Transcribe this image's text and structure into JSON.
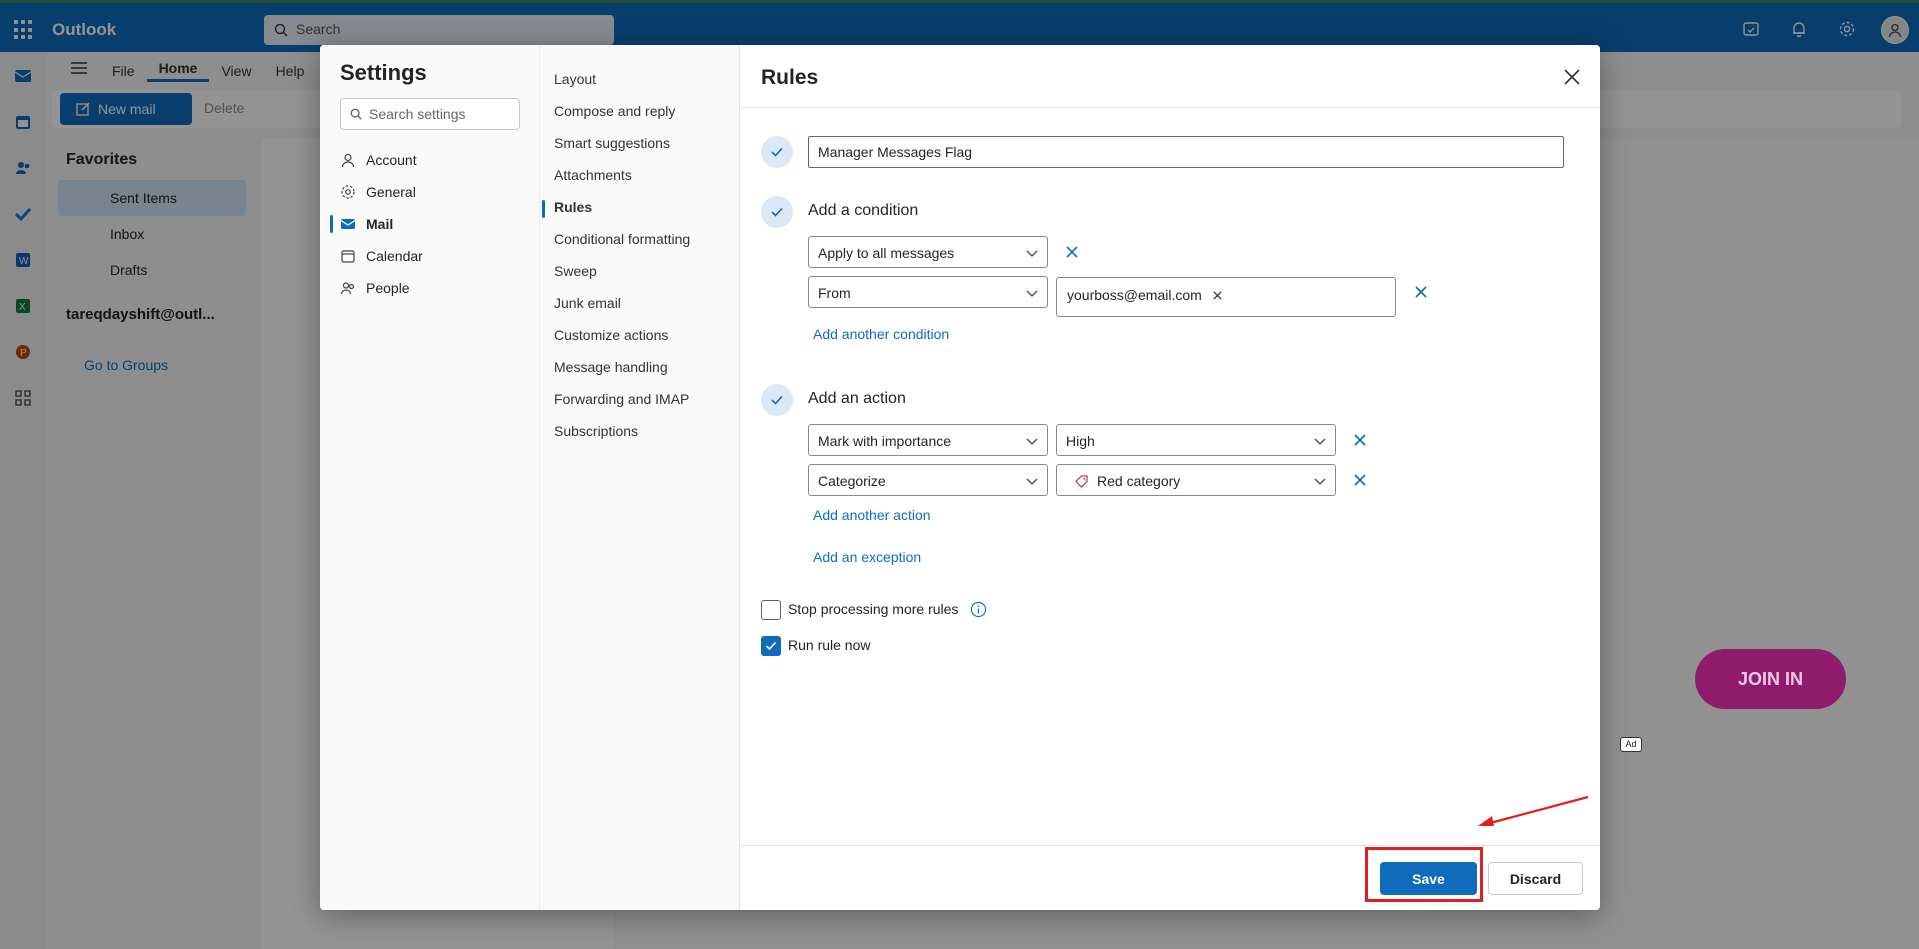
{
  "app": {
    "title": "Outlook",
    "search_placeholder": "Search",
    "ribbon_tabs": [
      "File",
      "Home",
      "View",
      "Help"
    ],
    "new_mail_label": "New mail",
    "delete_label": "Delete"
  },
  "folders": {
    "favorites_label": "Favorites",
    "items": [
      "Sent Items",
      "Inbox",
      "Drafts"
    ],
    "account": "tareqdayshift@outl...",
    "groups_link": "Go to Groups"
  },
  "ad": {
    "join_label": "JOIN IN",
    "badge": "Ad"
  },
  "settings": {
    "title": "Settings",
    "search_placeholder": "Search settings",
    "categories": [
      "Account",
      "General",
      "Mail",
      "Calendar",
      "People"
    ],
    "active_category": "Mail",
    "mail_sections": [
      "Layout",
      "Compose and reply",
      "Smart suggestions",
      "Attachments",
      "Rules",
      "Conditional formatting",
      "Sweep",
      "Junk email",
      "Customize actions",
      "Message handling",
      "Forwarding and IMAP",
      "Subscriptions"
    ],
    "active_section": "Rules"
  },
  "rules": {
    "title": "Rules",
    "rule_name": "Manager Messages Flag",
    "condition_heading": "Add a condition",
    "conditions": [
      {
        "field": "Apply to all messages"
      },
      {
        "field": "From",
        "value_chip": "yourboss@email.com"
      }
    ],
    "add_condition_link": "Add another condition",
    "action_heading": "Add an action",
    "actions": [
      {
        "field": "Mark with importance",
        "value": "High"
      },
      {
        "field": "Categorize",
        "value": "Red category"
      }
    ],
    "add_action_link": "Add another action",
    "add_exception_link": "Add an exception",
    "stop_processing_label": "Stop processing more rules",
    "stop_processing_checked": false,
    "run_now_label": "Run rule now",
    "run_now_checked": true,
    "save_label": "Save",
    "discard_label": "Discard"
  },
  "colors": {
    "accent": "#0f6cbd",
    "annotation": "#e02020",
    "category_red": "#c4314b"
  }
}
